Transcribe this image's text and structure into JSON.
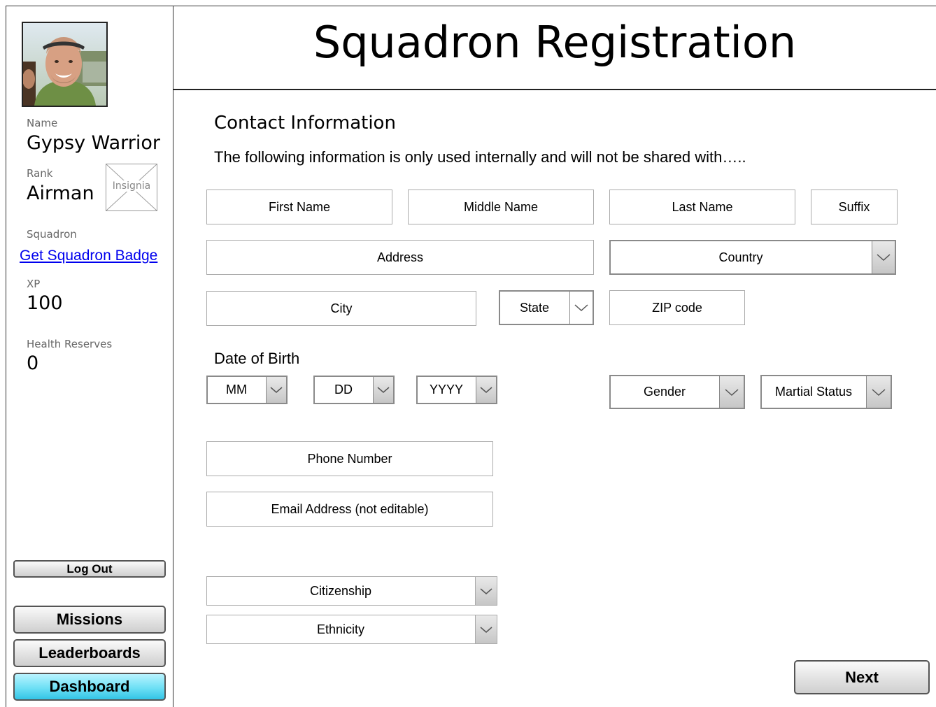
{
  "header": {
    "title": "Squadron Registration"
  },
  "profile": {
    "name_label": "Name",
    "name": "Gypsy Warrior",
    "rank_label": "Rank",
    "rank": "Airman",
    "insignia_placeholder": "Insignia",
    "squadron_label": "Squadron",
    "squadron_link": "Get Squadron Badge",
    "xp_label": "XP",
    "xp": "100",
    "health_label": "Health Reserves",
    "health": "0"
  },
  "nav": {
    "logout": "Log Out",
    "missions": "Missions",
    "leaderboards": "Leaderboards",
    "dashboard": "Dashboard",
    "active": "Dashboard"
  },
  "form": {
    "section_title": "Contact Information",
    "intro": "The following information is only used internally and will not be shared with…..",
    "first_name": "First Name",
    "middle_name": "Middle Name",
    "last_name": "Last Name",
    "suffix": "Suffix",
    "address": "Address",
    "country": "Country",
    "city": "City",
    "state": "State",
    "zip": "ZIP code",
    "dob_label": "Date of Birth",
    "dob_month": "MM",
    "dob_day": "DD",
    "dob_year": "YYYY",
    "gender": "Gender",
    "marital_status": "Martial Status",
    "phone": "Phone Number",
    "email": "Email Address (not editable)",
    "citizenship": "Citizenship",
    "ethnicity": "Ethnicity",
    "next": "Next"
  },
  "colors": {
    "link": "#0000ee",
    "active_button": "#6ee0f5"
  },
  "icons": {
    "dropdown": "chevron-down-icon",
    "avatar": "user-photo",
    "insignia": "image-placeholder-icon"
  }
}
